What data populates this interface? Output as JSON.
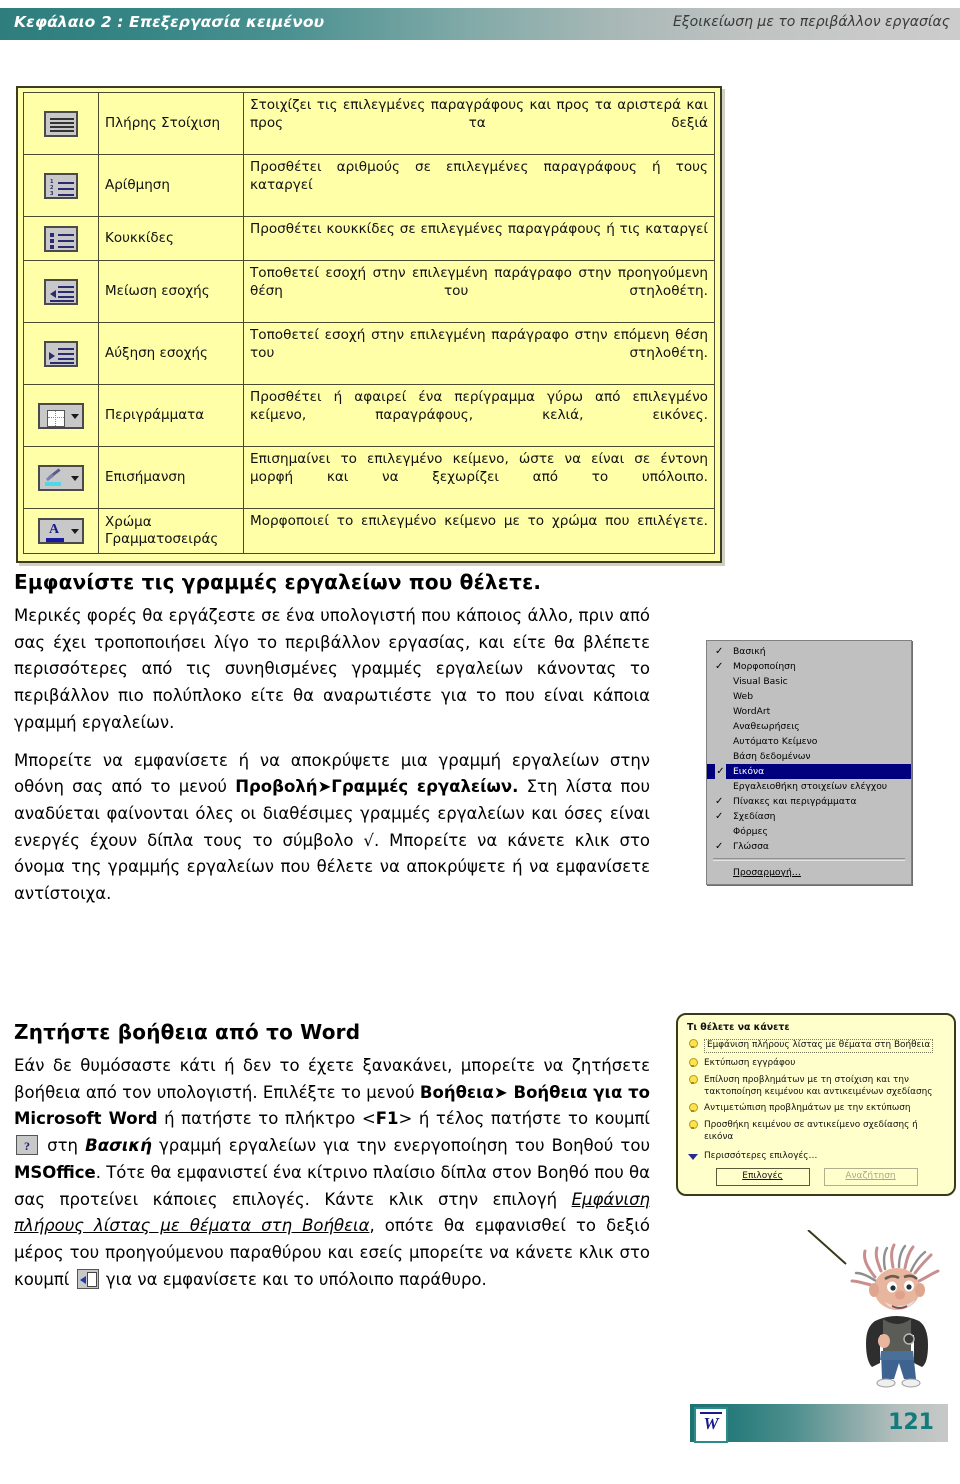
{
  "header": {
    "chapter": "Κεφάλαιο 2 : Επεξεργασία κειμένου",
    "section": "Εξοικείωση με το περιβάλλον εργασίας"
  },
  "toolbar_table": {
    "rows": [
      {
        "icon": "justify-icon",
        "name": "Πλήρης Στοίχιση",
        "description": "Στοιχίζει τις επιλεγμένες παραγράφους και προς τα αριστερά και προς τα δεξιά"
      },
      {
        "icon": "numbering-icon",
        "name": "Αρίθμηση",
        "description": "Προσθέτει αριθμούς σε επιλεγμένες παραγράφους ή τους καταργεί"
      },
      {
        "icon": "bullets-icon",
        "name": "Κουκκίδες",
        "description": "Προσθέτει κουκκίδες σε επιλεγμένες παραγράφους ή τις καταργεί"
      },
      {
        "icon": "decrease-indent-icon",
        "name": "Μείωση εσοχής",
        "description": "Τοποθετεί εσοχή στην επιλεγμένη παράγραφο στην προηγούμενη θέση του στηλοθέτη."
      },
      {
        "icon": "increase-indent-icon",
        "name": "Αύξηση εσοχής",
        "description": "Τοποθετεί εσοχή στην επιλεγμένη παράγραφο στην επόμενη θέση του στηλοθέτη."
      },
      {
        "icon": "borders-icon",
        "name": "Περιγράμματα",
        "description": "Προσθέτει ή αφαιρεί ένα περίγραμμα γύρω από επιλεγμένο κείμενο, παραγράφους, κελιά, εικόνες."
      },
      {
        "icon": "highlight-icon",
        "name": "Επισήμανση",
        "description": "Επισημαίνει το επιλεγμένο κείμενο, ώστε να είναι σε έντονη μορφή και να ξεχωρίζει από το υπόλοιπο."
      },
      {
        "icon": "font-color-icon",
        "name": "Χρώμα Γραμματοσειράς",
        "description": "Μορφοποιεί το επιλεγμένο κείμενο με το χρώμα που επιλέγετε."
      }
    ]
  },
  "section_toolbars": {
    "title": "Εμφανίστε τις γραμμές εργαλείων που θέλετε.",
    "p1": "Μερικές φορές θα εργάζεστε σε ένα υπολογιστή που κάποιος άλλο, πριν από σας έχει τροποποιήσει λίγο το περιβάλλον εργασίας, και είτε θα βλέπετε περισσότερες από τις συνηθισμένες γραμμές εργαλείων κάνοντας το περιβάλλον πιο πολύπλοκο είτε θα αναρωτιέστε  για το που είναι κάποια γραμμή εργαλείων.",
    "p2_a": "Μπορείτε να  εμφανίσετε ή να αποκρύψετε μια γραμμή εργαλείων στην οθόνη σας  από  το μενού ",
    "p2_menu": "Προβολή➤Γραμμές εργαλείων.",
    "p2_b": " Στη λίστα που αναδύεται φαίνονται όλες οι διαθέσιμες γραμμές εργαλείων και όσες είναι ενεργές έχουν δίπλα τους το σύμβολο √. Μπορείτε να κάνετε κλικ στο όνομα της γραμμής εργαλείων που θέλετε να  αποκρύψετε ή να εμφανίσετε αντίστοιχα."
  },
  "toolbars_menu": {
    "items": [
      {
        "label": "Βασική",
        "checked": true,
        "selected": false
      },
      {
        "label": "Μορφοποίηση",
        "checked": true,
        "selected": false
      },
      {
        "label": "Visual Basic",
        "checked": false,
        "selected": false
      },
      {
        "label": "Web",
        "checked": false,
        "selected": false
      },
      {
        "label": "WordArt",
        "checked": false,
        "selected": false
      },
      {
        "label": "Αναθεωρήσεις",
        "checked": false,
        "selected": false
      },
      {
        "label": "Αυτόματο Κείμενο",
        "checked": false,
        "selected": false
      },
      {
        "label": "Βάση δεδομένων",
        "checked": false,
        "selected": false
      },
      {
        "label": "Εικόνα",
        "checked": true,
        "selected": true
      },
      {
        "label": "Εργαλειοθήκη στοιχείων ελέγχου",
        "checked": false,
        "selected": false
      },
      {
        "label": "Πίνακες και περιγράμματα",
        "checked": true,
        "selected": false
      },
      {
        "label": "Σχεδίαση",
        "checked": true,
        "selected": false
      },
      {
        "label": "Φόρμες",
        "checked": false,
        "selected": false
      },
      {
        "label": "Γλώσσα",
        "checked": true,
        "selected": false
      }
    ],
    "customize": "Προσαρμογή…",
    "check_glyph": "✓",
    "selected_color": "#00007f"
  },
  "section_help": {
    "title": "Ζητήστε βοήθεια από το Word",
    "t1": "Εάν δε θυμόσαστε κάτι ή δεν το έχετε ξανακάνει, μπορείτε να ζητήσετε βοήθεια από τον υπολογιστή. Επιλέξτε το μενού ",
    "t2_b": "Βοήθεια➤ Βοήθεια για το Microsoft Word",
    "t3": " ή πατήστε το πλήκτρο <",
    "t4_b": "F1",
    "t5": "> ή τέλος πατήστε το κουμπί ",
    "t6": " στη ",
    "t7_bi": "Βασική",
    "t8": " γραμμή εργαλείων για την ενεργοποίηση του Βοηθού του ",
    "t9_b": "MSOffice",
    "t10": ". Τότε θα εμφανιστεί ένα κίτρινο πλαίσιο δίπλα στον Βοηθό που θα σας προτείνει κάποιες επιλογές. Κάντε κλικ στην επιλογή ",
    "t11_ul": "Εμφάνιση πλήρους λίστας με θέματα στη Βοήθεια",
    "t12": ", οπότε θα εμφανισθεί το δεξιό μέρος του προηγούμενου παραθύρου και εσείς μπορείτε να κάνετε κλικ στο κουμπί ",
    "t13": " για να εμφανίσετε και το υπόλοιπο παράθυρο.",
    "help_button_icon": "question-mark-button-icon",
    "show_pane_button_icon": "show-pane-button-icon"
  },
  "assistant_balloon": {
    "title": "Τι θέλετε να κάνετε",
    "items": [
      "Εμφάνιση πλήρους λίστας με θέματα στη Βοήθεια",
      "Εκτύπωση εγγράφου",
      "Επίλυση προβλημάτων με τη στοίχιση και την τακτοποίηση κειμένου και αντικειμένων σχεδίασης",
      "Αντιμετώπιση προβλημάτων με την εκτύπωση",
      "Προσθήκη κειμένου σε αντικείμενο σχεδίασης ή εικόνα"
    ],
    "more": "Περισσότερες επιλογές…",
    "btn_options": "Επιλογές",
    "btn_search": "Αναζήτηση"
  },
  "footer": {
    "page_number": "121",
    "app_icon": "word-logo-icon"
  }
}
